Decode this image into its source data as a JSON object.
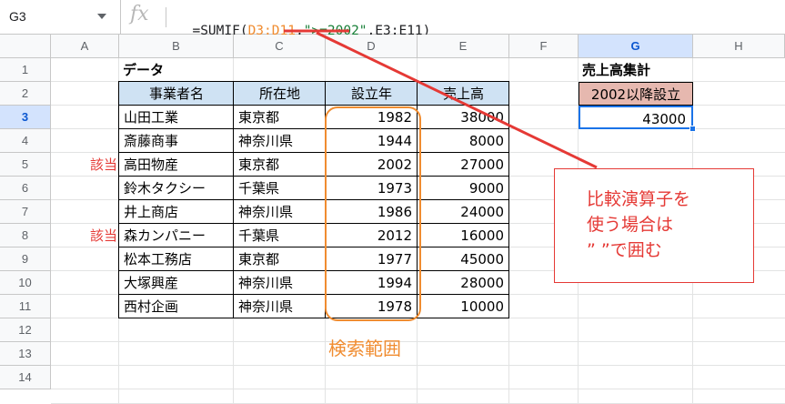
{
  "formula_bar": {
    "cell_ref": "G3",
    "fx_label": "fx",
    "formula_parts": [
      {
        "text": "=SUMIF(",
        "color": "#202124"
      },
      {
        "text": "D3:D11",
        "color": "#f08c30"
      },
      {
        "text": ",",
        "color": "#202124"
      },
      {
        "text": "\">=2002\"",
        "color": "#188038"
      },
      {
        "text": ",E3:E11)",
        "color": "#202124"
      }
    ]
  },
  "columns": [
    "A",
    "B",
    "C",
    "D",
    "E",
    "F",
    "G",
    "H"
  ],
  "rows": [
    "1",
    "2",
    "3",
    "4",
    "5",
    "6",
    "7",
    "8",
    "9",
    "10",
    "11",
    "12",
    "13",
    "14"
  ],
  "table": {
    "title": "データ",
    "headers": [
      "事業者名",
      "所在地",
      "設立年",
      "売上高"
    ],
    "rows": [
      [
        "山田工業",
        "東京都",
        "1982",
        "38000"
      ],
      [
        "斎藤商事",
        "神奈川県",
        "1944",
        "8000"
      ],
      [
        "高田物産",
        "東京都",
        "2002",
        "27000"
      ],
      [
        "鈴木タクシー",
        "千葉県",
        "1973",
        "9000"
      ],
      [
        "井上商店",
        "神奈川県",
        "1986",
        "24000"
      ],
      [
        "森カンパニー",
        "千葉県",
        "2012",
        "16000"
      ],
      [
        "松本工務店",
        "東京都",
        "1977",
        "45000"
      ],
      [
        "大塚興産",
        "神奈川県",
        "1994",
        "28000"
      ],
      [
        "西村企画",
        "神奈川県",
        "1978",
        "10000"
      ]
    ]
  },
  "marks": {
    "row5": "該当",
    "row8": "該当"
  },
  "summary": {
    "title": "売上高集計",
    "header": "2002以降設立",
    "value": "43000"
  },
  "annotation": {
    "callout_lines": [
      "比較演算子を",
      "使う場合は",
      "” ”で囲む"
    ],
    "search_range_label": "検索範囲"
  },
  "colors": {
    "accent_red": "#e53935",
    "orange": "#f08c30",
    "header_blue": "#cfe2f3",
    "summary_pink": "#e6b8af",
    "selection_blue": "#1a73e8"
  }
}
